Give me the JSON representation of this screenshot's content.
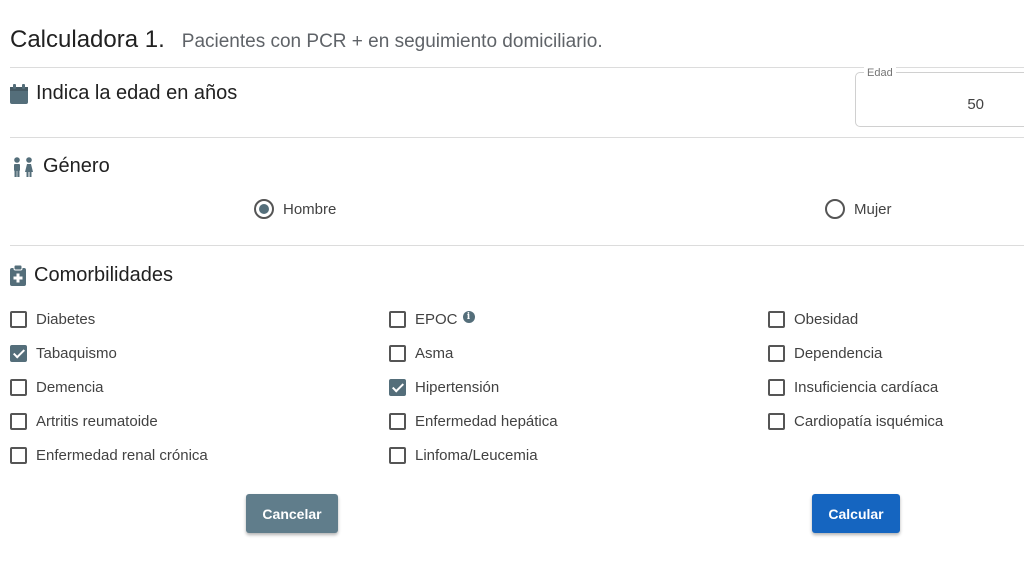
{
  "header": {
    "title": "Calculadora 1.",
    "subtitle": "Pacientes con PCR + en seguimiento domiciliario."
  },
  "age_section": {
    "title": "Indica la edad en años",
    "field_label": "Edad",
    "value": "50"
  },
  "gender_section": {
    "title": "Género",
    "options": [
      {
        "label": "Hombre",
        "selected": true
      },
      {
        "label": "Mujer",
        "selected": false
      }
    ]
  },
  "comorbidities_section": {
    "title": "Comorbilidades",
    "items": [
      {
        "label": "Diabetes",
        "checked": false
      },
      {
        "label": "Tabaquismo",
        "checked": true
      },
      {
        "label": "Demencia",
        "checked": false
      },
      {
        "label": "Artritis reumatoide",
        "checked": false
      },
      {
        "label": "Enfermedad renal crónica",
        "checked": false
      },
      {
        "label": "EPOC",
        "checked": false,
        "info": true
      },
      {
        "label": "Asma",
        "checked": false
      },
      {
        "label": "Hipertensión",
        "checked": true
      },
      {
        "label": "Enfermedad hepática",
        "checked": false
      },
      {
        "label": "Linfoma/Leucemia",
        "checked": false
      },
      {
        "label": "Obesidad",
        "checked": false
      },
      {
        "label": "Dependencia",
        "checked": false
      },
      {
        "label": "Insuficiencia cardíaca",
        "checked": false
      },
      {
        "label": "Cardiopatía isquémica",
        "checked": false
      }
    ]
  },
  "buttons": {
    "cancel_label": "Cancelar",
    "calculate_label": "Calcular"
  },
  "colors": {
    "accent": "#546e7a",
    "primary_button": "#1565c0",
    "secondary_button": "#607d8b"
  },
  "icons": {
    "age": "calendar-icon",
    "gender": "people-icon",
    "comorbidities": "medical-clipboard-icon",
    "epoc_info": "info-icon"
  }
}
